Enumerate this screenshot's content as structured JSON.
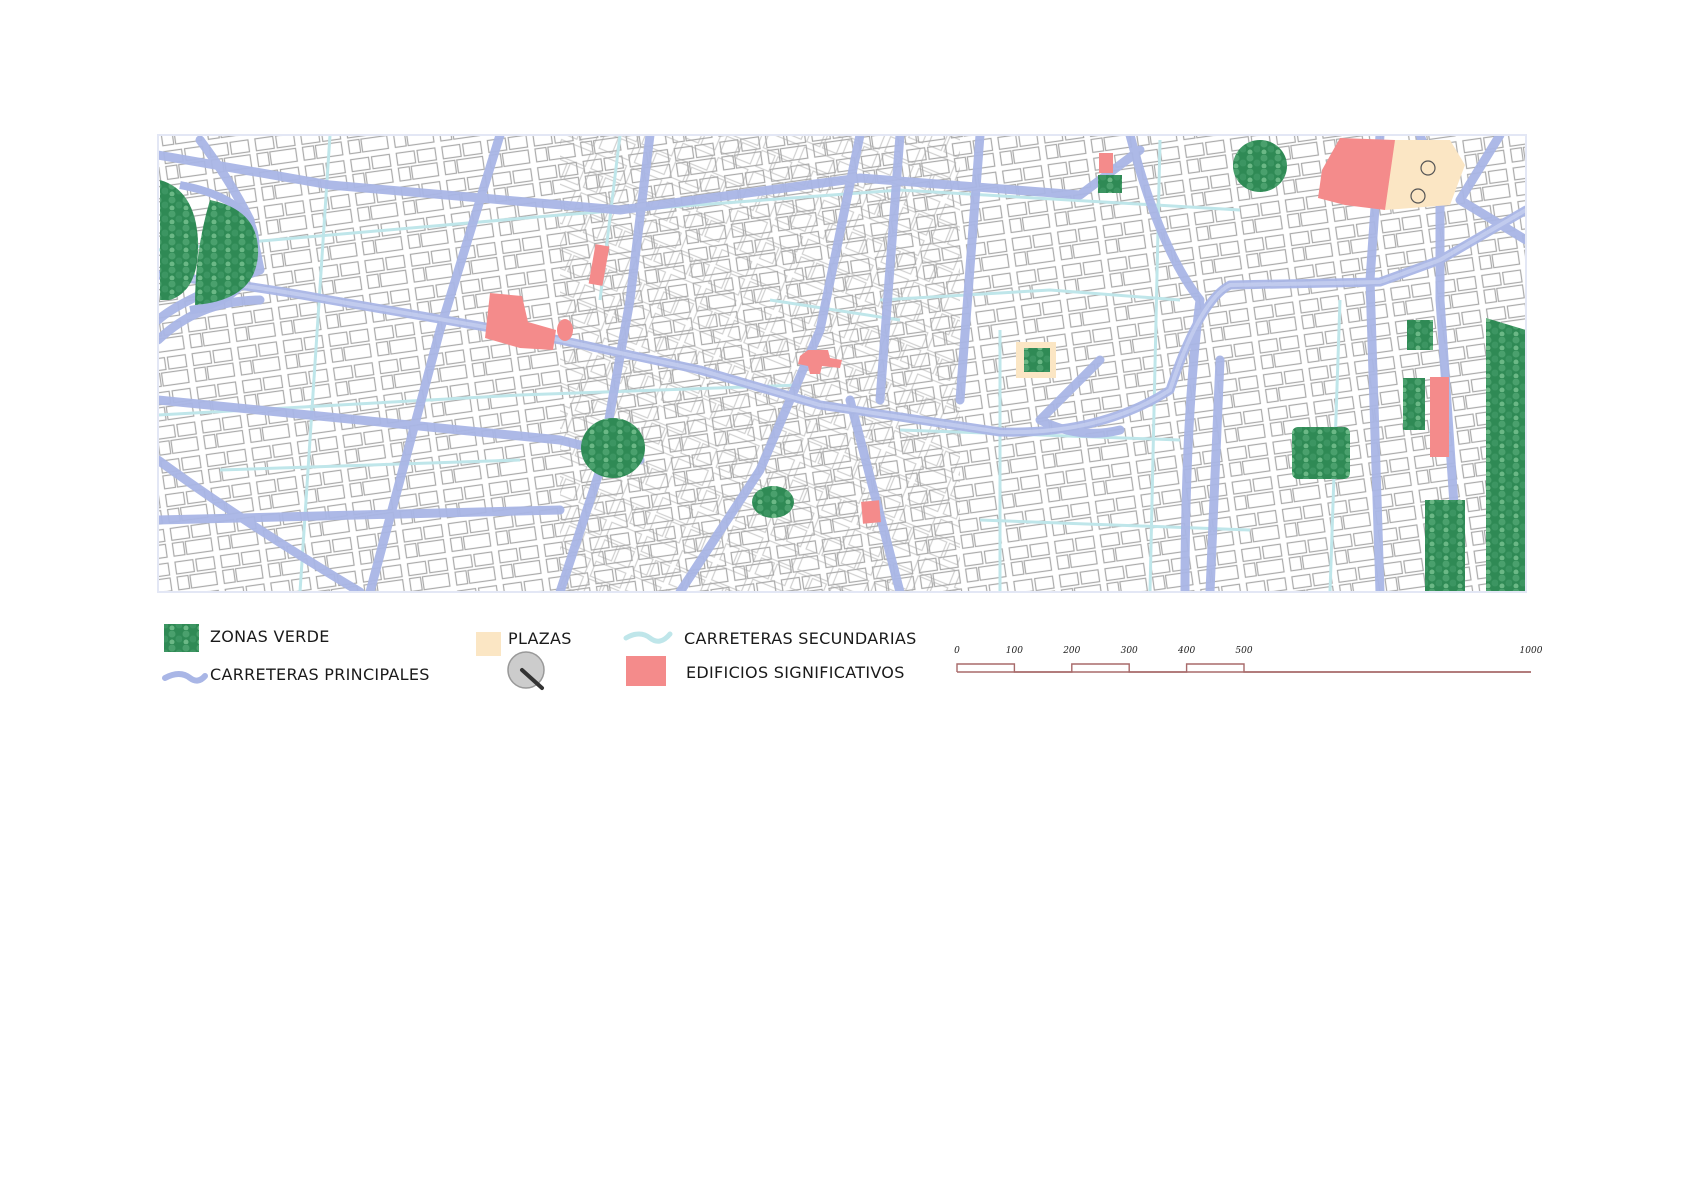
{
  "legend": {
    "green_zones": "ZONAS VERDE",
    "main_roads": "CARRETERAS PRINCIPALES",
    "plazas": "PLAZAS",
    "secondary_roads": "CARRETERAS SECUNDARIAS",
    "significant_buildings": "EDIFICIOS SIGNIFICATIVOS"
  },
  "scale_bar": {
    "ticks": [
      "0",
      "100",
      "200",
      "300",
      "400",
      "500",
      "1000"
    ],
    "values": [
      0,
      100,
      200,
      300,
      400,
      500,
      1000
    ]
  },
  "colors": {
    "green_zone": "#2f8a55",
    "green_zone_light": "#5fae7c",
    "main_road": "#a9b6e6",
    "secondary_road": "#bfe6ea",
    "plaza": "#fbe6c4",
    "significant_building": "#f48b8b",
    "block_outline": "#a9a9a9",
    "scale_bar": "#a86a6a"
  },
  "icons": {
    "green_zone_swatch": "tree-canopy-icon",
    "main_road_swatch": "wavy-road-icon",
    "secondary_road_swatch": "wavy-road-icon",
    "plaza_swatch": "plaza-square-icon",
    "building_swatch": "building-square-icon",
    "search_marker": "magnifier-icon"
  }
}
